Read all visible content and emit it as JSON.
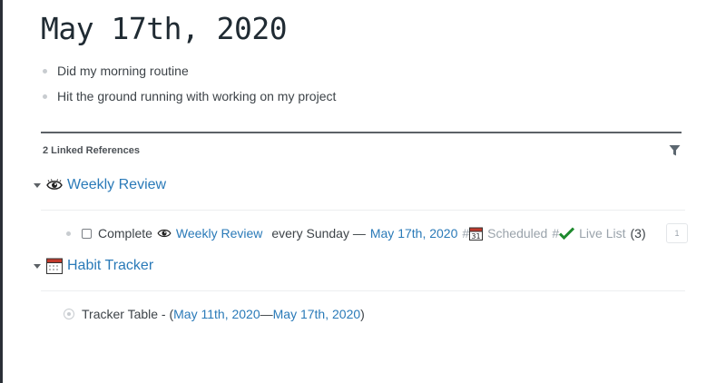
{
  "page": {
    "title": "May 17th, 2020"
  },
  "blocks": [
    {
      "text": "Did my morning routine"
    },
    {
      "text": "Hit the ground running with working on my project"
    }
  ],
  "references": {
    "header": "2 Linked References",
    "groups": [
      {
        "icon": "eye-icon",
        "title": "Weekly Review",
        "rows": [
          {
            "prefix": "Complete",
            "link1": "Weekly Review",
            "middle": "every Sunday —",
            "link2": "May 17th, 2020",
            "hash1": "#",
            "tag1": "Scheduled",
            "hash2": "#",
            "tag2": "Live List",
            "count_text": "(3)",
            "badge": "1"
          }
        ]
      },
      {
        "icon": "calendar-icon",
        "title": "Habit Tracker",
        "rows": [
          {
            "prefix": "Tracker Table - (",
            "link1": "May 11th, 2020",
            "dash": "—",
            "link2": "May 17th, 2020",
            "suffix": ")"
          }
        ]
      }
    ]
  },
  "colors": {
    "link": "#2a7ab8",
    "tag": "#9aa3ab",
    "title": "#202b33"
  }
}
